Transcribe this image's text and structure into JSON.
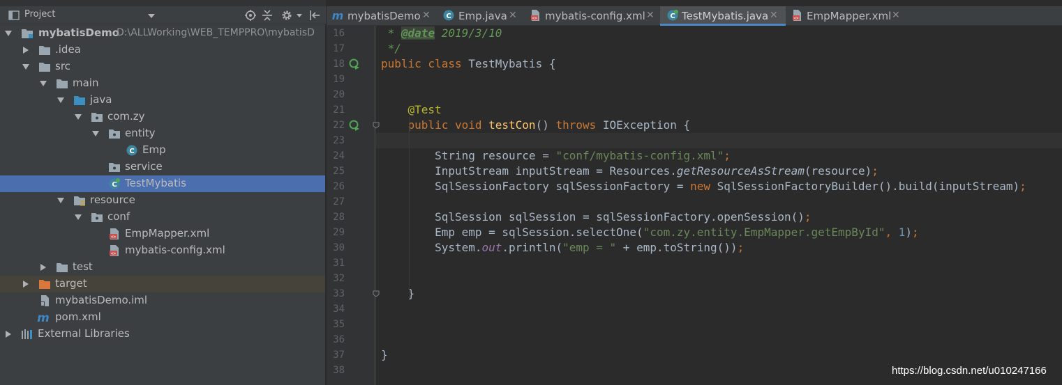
{
  "project_panel": {
    "title": "Project",
    "tree": [
      {
        "label": "mybatisDemo",
        "path": "D:\\ALLWorking\\WEB_TEMPPRO\\mybatisD",
        "icon": "module-folder-icon",
        "expanded": true
      },
      {
        "label": ".idea",
        "icon": "folder-icon",
        "expanded": false
      },
      {
        "label": "src",
        "icon": "folder-icon",
        "expanded": true
      },
      {
        "label": "main",
        "icon": "folder-icon",
        "expanded": true
      },
      {
        "label": "java",
        "icon": "source-folder-icon",
        "expanded": true
      },
      {
        "label": "com.zy",
        "icon": "package-icon",
        "expanded": true
      },
      {
        "label": "entity",
        "icon": "package-icon",
        "expanded": true
      },
      {
        "label": "Emp",
        "icon": "java-class-icon"
      },
      {
        "label": "service",
        "icon": "package-icon"
      },
      {
        "label": "TestMybatis",
        "icon": "test-class-icon",
        "selected": true
      },
      {
        "label": "resource",
        "icon": "resource-folder-icon",
        "expanded": true
      },
      {
        "label": "conf",
        "icon": "package-icon",
        "expanded": true
      },
      {
        "label": "EmpMapper.xml",
        "icon": "xml-file-icon"
      },
      {
        "label": "mybatis-config.xml",
        "icon": "xml-file-icon"
      },
      {
        "label": "test",
        "icon": "folder-icon",
        "expanded": false
      },
      {
        "label": "target",
        "icon": "excluded-folder-icon",
        "expanded": false
      },
      {
        "label": "mybatisDemo.iml",
        "icon": "iml-file-icon"
      },
      {
        "label": "pom.xml",
        "icon": "maven-icon"
      },
      {
        "label": "External Libraries",
        "icon": "libraries-icon",
        "expanded": false
      }
    ]
  },
  "tabs": [
    {
      "label": "mybatisDemo",
      "icon": "maven-icon"
    },
    {
      "label": "Emp.java",
      "icon": "java-class-icon"
    },
    {
      "label": "mybatis-config.xml",
      "icon": "xml-file-icon"
    },
    {
      "label": "TestMybatis.java",
      "icon": "test-class-icon",
      "active": true
    },
    {
      "label": "EmpMapper.xml",
      "icon": "xml-file-icon"
    }
  ],
  "editor": {
    "caret_line": 23,
    "lines": [
      {
        "n": "16",
        "tokens": [
          {
            "t": " * ",
            "c": "doc"
          },
          {
            "t": "@date",
            "c": "doctag"
          },
          {
            "t": " 2019/3/10",
            "c": "doc"
          }
        ]
      },
      {
        "n": "17",
        "tokens": [
          {
            "t": " */",
            "c": "doc"
          }
        ]
      },
      {
        "n": "18",
        "run": true,
        "tokens": [
          {
            "t": "public class ",
            "c": "kw"
          },
          {
            "t": "TestMybatis {",
            "c": ""
          }
        ]
      },
      {
        "n": "19",
        "tokens": []
      },
      {
        "n": "20",
        "tokens": []
      },
      {
        "n": "21",
        "tokens": [
          {
            "t": "    ",
            "c": ""
          },
          {
            "t": "@Test",
            "c": "ann"
          }
        ]
      },
      {
        "n": "22",
        "run": true,
        "fold": true,
        "tokens": [
          {
            "t": "    ",
            "c": ""
          },
          {
            "t": "public void ",
            "c": "kw"
          },
          {
            "t": "testCon",
            "c": "fn"
          },
          {
            "t": "() ",
            "c": ""
          },
          {
            "t": "throws ",
            "c": "kw"
          },
          {
            "t": "IOException {",
            "c": ""
          }
        ]
      },
      {
        "n": "23",
        "tokens": []
      },
      {
        "n": "24",
        "tokens": [
          {
            "t": "        String resource = ",
            "c": ""
          },
          {
            "t": "\"conf/mybatis-config.xml\"",
            "c": "str"
          },
          {
            "t": ";",
            "c": "kw"
          }
        ]
      },
      {
        "n": "25",
        "tokens": [
          {
            "t": "        InputStream inputStream = Resources.",
            "c": ""
          },
          {
            "t": "getResourceAsStream",
            "c": "ital"
          },
          {
            "t": "(resource)",
            "c": ""
          },
          {
            "t": ";",
            "c": "kw"
          }
        ]
      },
      {
        "n": "26",
        "tokens": [
          {
            "t": "        SqlSessionFactory sqlSessionFactory = ",
            "c": ""
          },
          {
            "t": "new ",
            "c": "kw"
          },
          {
            "t": "SqlSessionFactoryBuilder().build(inputStream)",
            "c": ""
          },
          {
            "t": ";",
            "c": "kw"
          }
        ]
      },
      {
        "n": "27",
        "tokens": []
      },
      {
        "n": "28",
        "tokens": [
          {
            "t": "        SqlSession sqlSession = sqlSessionFactory.openSession()",
            "c": ""
          },
          {
            "t": ";",
            "c": "kw"
          }
        ]
      },
      {
        "n": "29",
        "tokens": [
          {
            "t": "        Emp emp = sqlSession.selectOne(",
            "c": ""
          },
          {
            "t": "\"com.zy.entity.EmpMapper.getEmpById\"",
            "c": "str"
          },
          {
            "t": ", ",
            "c": "kw"
          },
          {
            "t": "1",
            "c": "num"
          },
          {
            "t": ")",
            "c": ""
          },
          {
            "t": ";",
            "c": "kw"
          }
        ]
      },
      {
        "n": "30",
        "tokens": [
          {
            "t": "        System.",
            "c": ""
          },
          {
            "t": "out",
            "c": "fld"
          },
          {
            "t": ".println(",
            "c": ""
          },
          {
            "t": "\"emp = \"",
            "c": "str"
          },
          {
            "t": " + emp.toString())",
            "c": ""
          },
          {
            "t": ";",
            "c": "kw"
          }
        ]
      },
      {
        "n": "31",
        "tokens": []
      },
      {
        "n": "32",
        "tokens": []
      },
      {
        "n": "33",
        "fold": true,
        "tokens": [
          {
            "t": "    }",
            "c": ""
          }
        ]
      },
      {
        "n": "34",
        "tokens": []
      },
      {
        "n": "35",
        "tokens": []
      },
      {
        "n": "36",
        "tokens": []
      },
      {
        "n": "37",
        "tokens": [
          {
            "t": "}",
            "c": ""
          }
        ]
      },
      {
        "n": "38",
        "tokens": []
      }
    ]
  },
  "watermark": "https://blog.csdn.net/u010247166",
  "colors": {
    "panel_bg": "#3c3f41",
    "editor_bg": "#2b2b2b",
    "selection": "#4b6eaf",
    "keyword": "#cc7832",
    "string": "#6a8759",
    "annotation": "#bbb529",
    "method": "#ffc66d"
  }
}
